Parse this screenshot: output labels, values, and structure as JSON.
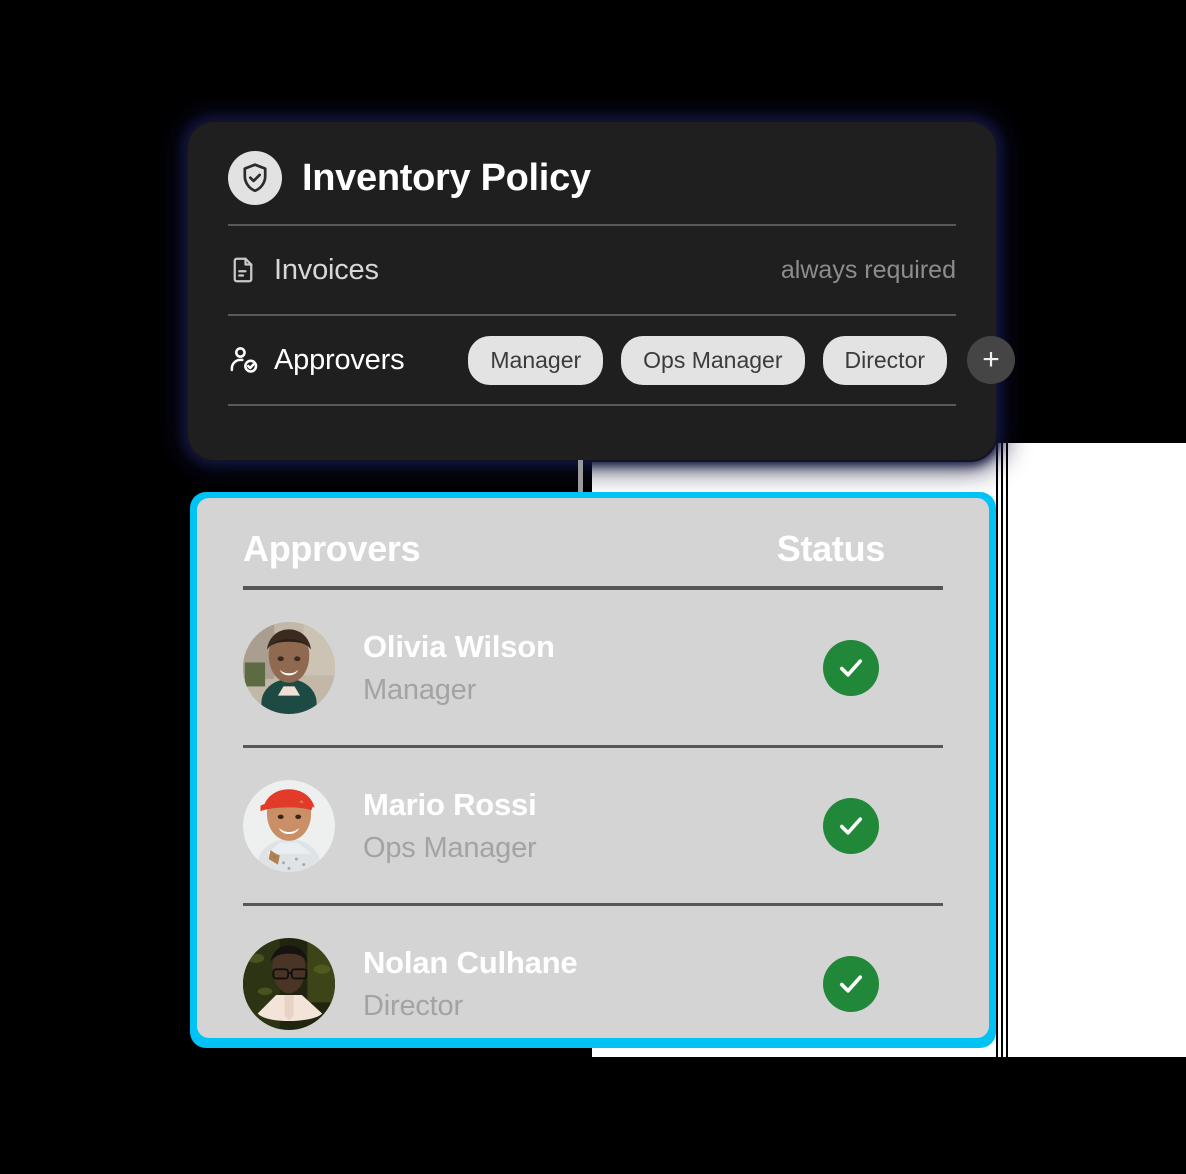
{
  "policy_card": {
    "icon": "shield-check-icon",
    "title": "Inventory Policy",
    "rows": [
      {
        "icon": "document-icon",
        "label": "Invoices",
        "value": "always required"
      },
      {
        "icon": "user-check-icon",
        "label": "Approvers",
        "chips": [
          "Manager",
          "Ops Manager",
          "Director"
        ],
        "add_label": "+"
      }
    ]
  },
  "approvers_panel": {
    "accent_color": "#00c3f5",
    "background_color": "#d4d4d4",
    "headers": {
      "approvers": "Approvers",
      "status": "Status"
    },
    "rows": [
      {
        "avatar": "photo-olivia-wilson",
        "name": "Olivia Wilson",
        "role": "Manager",
        "status_icon": "check-circle-icon",
        "status_color": "#218739"
      },
      {
        "avatar": "photo-mario-rossi",
        "name": "Mario Rossi",
        "role": "Ops Manager",
        "status_icon": "check-circle-icon",
        "status_color": "#218739"
      },
      {
        "avatar": "photo-nolan-culhane",
        "name": "Nolan Culhane",
        "role": "Director",
        "status_icon": "check-circle-icon",
        "status_color": "#218739"
      }
    ]
  }
}
